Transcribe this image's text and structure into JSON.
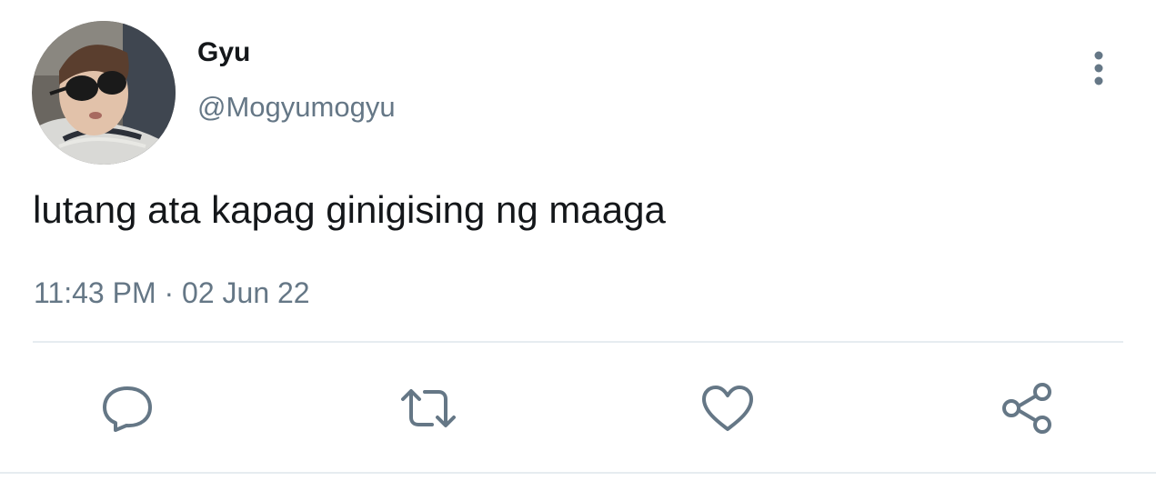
{
  "tweet": {
    "author": {
      "display_name": "Gyu",
      "handle": "@Mogyumogyu",
      "avatar_icon": "profile-photo"
    },
    "text": "lutang ata kapag ginigising ng maaga",
    "timestamp": "11:43 PM · 02 Jun 22",
    "actions": [
      {
        "name": "reply",
        "icon": "speech-bubble-icon"
      },
      {
        "name": "retweet",
        "icon": "retweet-arrows-icon"
      },
      {
        "name": "like",
        "icon": "heart-icon"
      },
      {
        "name": "share",
        "icon": "share-nodes-icon"
      }
    ],
    "more_icon": "vertical-ellipsis-icon"
  },
  "colors": {
    "text_primary": "#14171a",
    "text_secondary": "#657786",
    "divider": "#e6ecf0",
    "icon": "#657786"
  }
}
